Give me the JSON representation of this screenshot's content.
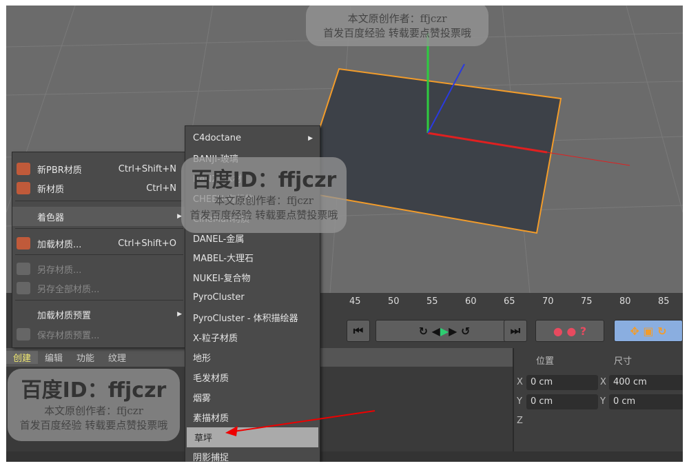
{
  "main_menu": {
    "items": [
      {
        "label": "新PBR材质",
        "shortcut": "Ctrl+Shift+N",
        "disabled": false
      },
      {
        "label": "新材质",
        "shortcut": "Ctrl+N",
        "disabled": false
      },
      {
        "label": "着色器",
        "shortcut": "",
        "disabled": false
      },
      {
        "label": "加载材质...",
        "shortcut": "Ctrl+Shift+O",
        "disabled": false
      },
      {
        "label": "另存材质...",
        "shortcut": "",
        "disabled": true
      },
      {
        "label": "另存全部材质...",
        "shortcut": "",
        "disabled": true
      },
      {
        "label": "加载材质预置",
        "shortcut": "",
        "disabled": false
      },
      {
        "label": "保存材质预置...",
        "shortcut": "",
        "disabled": true
      }
    ]
  },
  "submenu": {
    "items": [
      "C4doctane",
      "BANJI-玻璃",
      "BANZI-木材",
      "CHEEN-有机物",
      "CineMan材质",
      "DANEL-金属",
      "MABEL-大理石",
      "NUKEI-复合物",
      "PyroCluster",
      "PyroCluster - 体积描绘器",
      "X-粒子材质",
      "地形",
      "毛发材质",
      "烟雾",
      "素描材质",
      "草坪",
      "阴影捕捉"
    ],
    "highlighted": "草坪"
  },
  "timeline": {
    "ticks": [
      "45",
      "50",
      "55",
      "60",
      "65",
      "70",
      "75",
      "80",
      "85"
    ]
  },
  "tabs": [
    "创建",
    "编辑",
    "功能",
    "纹理"
  ],
  "active_tab": "创建",
  "coords": {
    "position_label": "位置",
    "size_label": "尺寸",
    "pos_x": "0 cm",
    "pos_y": "0 cm",
    "size_x": "400 cm",
    "size_y": "0 cm",
    "x": "X",
    "y": "Y",
    "z": "Z"
  },
  "watermark": {
    "id": "百度ID：ffjczr",
    "author": "本文原创作者：ffjczr",
    "note": "首发百度经验  转载要点赞投票哦"
  },
  "colors": {
    "accent": "#f39c2a",
    "highlight": "#aaaaaa"
  }
}
